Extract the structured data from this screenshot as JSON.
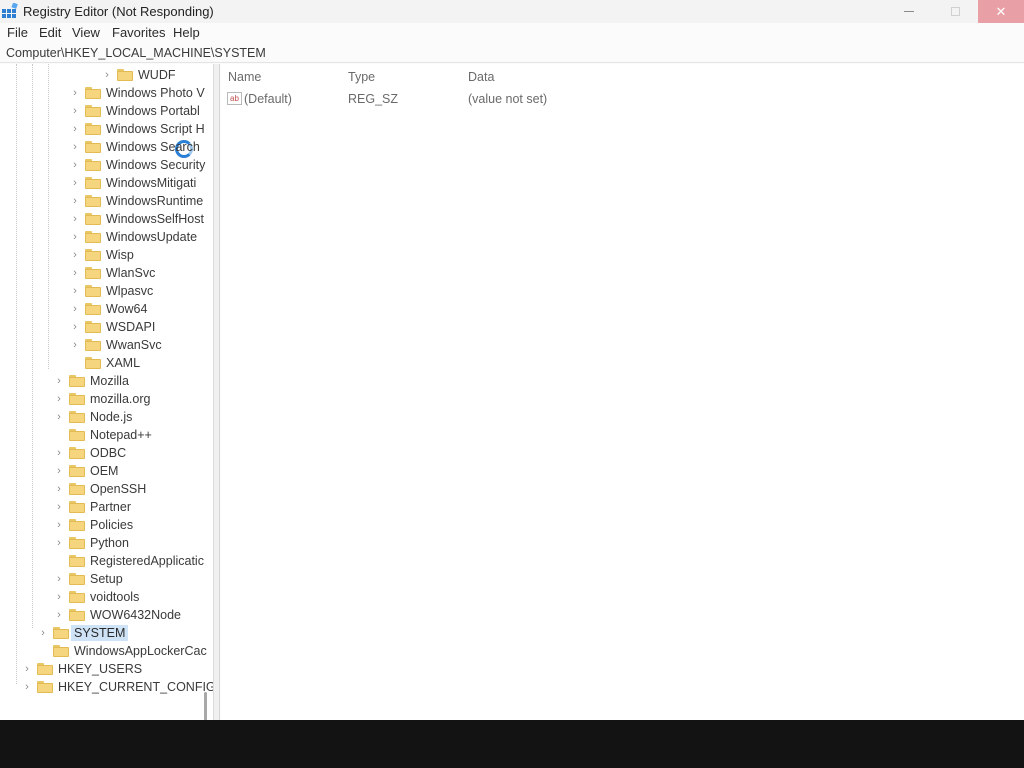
{
  "window": {
    "title": "Registry Editor (Not Responding)",
    "icon": "regedit-icon",
    "controls": {
      "minimize": "minimize-icon",
      "maximize": "maximize-icon",
      "close": "✕"
    }
  },
  "menu": {
    "items": [
      {
        "label": "File"
      },
      {
        "label": "Edit"
      },
      {
        "label": "View"
      },
      {
        "label": "Favorites"
      },
      {
        "label": "Help"
      }
    ]
  },
  "address": {
    "path": "Computer\\HKEY_LOCAL_MACHINE\\SYSTEM"
  },
  "tree": {
    "items": [
      {
        "label": "WUDF",
        "expandable": true,
        "selected": false
      },
      {
        "label": "Windows Photo V",
        "expandable": true,
        "selected": false
      },
      {
        "label": "Windows Portabl",
        "expandable": true,
        "selected": false
      },
      {
        "label": "Windows Script H",
        "expandable": true,
        "selected": false
      },
      {
        "label": "Windows Search",
        "expandable": true,
        "selected": false
      },
      {
        "label": "Windows Security",
        "expandable": true,
        "selected": false
      },
      {
        "label": "WindowsMitigati",
        "expandable": true,
        "selected": false
      },
      {
        "label": "WindowsRuntime",
        "expandable": true,
        "selected": false
      },
      {
        "label": "WindowsSelfHost",
        "expandable": true,
        "selected": false
      },
      {
        "label": "WindowsUpdate",
        "expandable": true,
        "selected": false
      },
      {
        "label": "Wisp",
        "expandable": true,
        "selected": false
      },
      {
        "label": "WlanSvc",
        "expandable": true,
        "selected": false
      },
      {
        "label": "Wlpasvc",
        "expandable": true,
        "selected": false
      },
      {
        "label": "Wow64",
        "expandable": true,
        "selected": false
      },
      {
        "label": "WSDAPI",
        "expandable": true,
        "selected": false
      },
      {
        "label": "WwanSvc",
        "expandable": true,
        "selected": false
      },
      {
        "label": "XAML",
        "expandable": false,
        "selected": false
      },
      {
        "label": "Mozilla",
        "expandable": true,
        "selected": false
      },
      {
        "label": "mozilla.org",
        "expandable": true,
        "selected": false
      },
      {
        "label": "Node.js",
        "expandable": true,
        "selected": false
      },
      {
        "label": "Notepad++",
        "expandable": false,
        "selected": false
      },
      {
        "label": "ODBC",
        "expandable": true,
        "selected": false
      },
      {
        "label": "OEM",
        "expandable": true,
        "selected": false
      },
      {
        "label": "OpenSSH",
        "expandable": true,
        "selected": false
      },
      {
        "label": "Partner",
        "expandable": true,
        "selected": false
      },
      {
        "label": "Policies",
        "expandable": true,
        "selected": false
      },
      {
        "label": "Python",
        "expandable": true,
        "selected": false
      },
      {
        "label": "RegisteredApplicatic",
        "expandable": false,
        "selected": false
      },
      {
        "label": "Setup",
        "expandable": true,
        "selected": false
      },
      {
        "label": "voidtools",
        "expandable": true,
        "selected": false
      },
      {
        "label": "WOW6432Node",
        "expandable": true,
        "selected": false
      },
      {
        "label": "SYSTEM",
        "expandable": true,
        "selected": true
      },
      {
        "label": "WindowsAppLockerCac",
        "expandable": false,
        "selected": false
      },
      {
        "label": "HKEY_USERS",
        "expandable": true,
        "selected": false
      },
      {
        "label": "HKEY_CURRENT_CONFIG",
        "expandable": true,
        "selected": false
      }
    ]
  },
  "values": {
    "columns": [
      "Name",
      "Type",
      "Data"
    ],
    "rows": [
      {
        "icon": "ab",
        "name": "(Default)",
        "type": "REG_SZ",
        "data": "(value not set)"
      }
    ]
  },
  "colors": {
    "selection": "#cfe3f7",
    "folder": "#f6d57f",
    "close_button": "#e8a0a6",
    "busy_cursor": "#2a7fd6"
  }
}
